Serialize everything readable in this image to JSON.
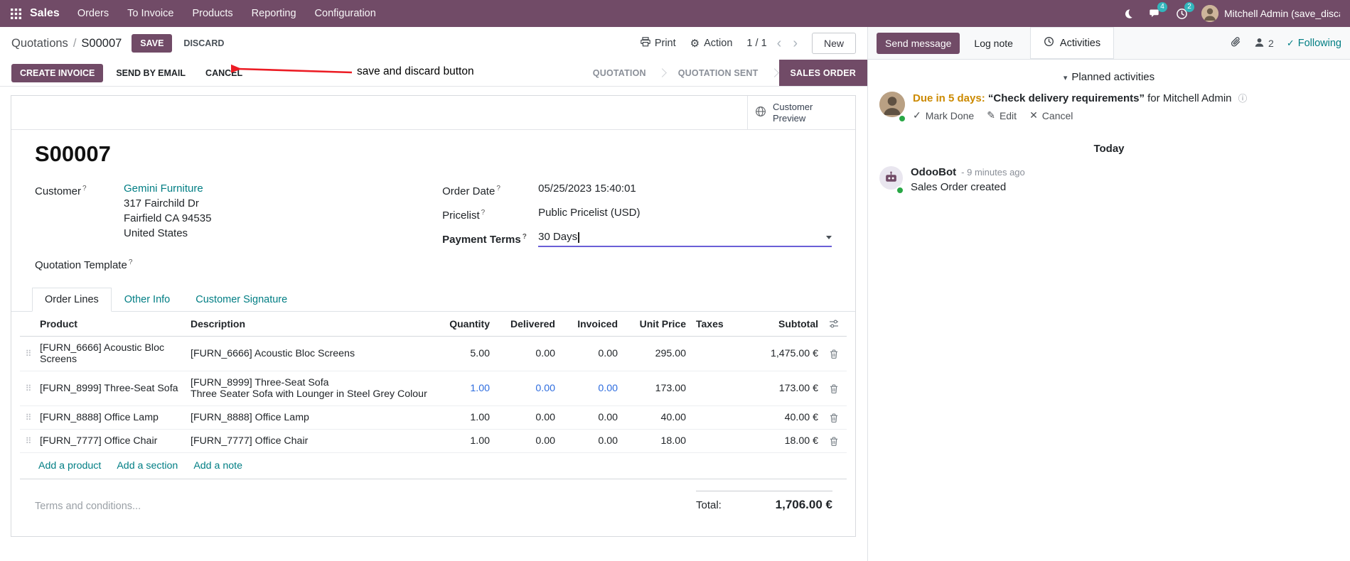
{
  "colors": {
    "primary": "#714B67",
    "link": "#017e84",
    "edited_blue": "#2d6cdf",
    "annotation_red": "#ec1c24",
    "due_orange": "#cc8a00",
    "success_green": "#28a745"
  },
  "nav": {
    "app": "Sales",
    "menus": [
      "Orders",
      "To Invoice",
      "Products",
      "Reporting",
      "Configuration"
    ],
    "badges": {
      "messages": "4",
      "activities": "2"
    },
    "user": "Mitchell Admin (save_discar"
  },
  "cp": {
    "breadcrumb_parent": "Quotations",
    "sep": "/",
    "breadcrumb_current": "S00007",
    "save": "SAVE",
    "discard": "DISCARD",
    "annotation": "save and discard button",
    "print": "Print",
    "action": "Action",
    "pager": "1 / 1",
    "prev": "‹",
    "next": "›",
    "new": "New"
  },
  "sb": {
    "create_invoice": "CREATE INVOICE",
    "send_by_email": "SEND BY EMAIL",
    "cancel": "CANCEL",
    "states": [
      "QUOTATION",
      "QUOTATION SENT",
      "SALES ORDER"
    ],
    "active_state": "SALES ORDER"
  },
  "form": {
    "customer_preview": "Customer Preview",
    "title": "S00007",
    "help": "?",
    "customer": {
      "label": "Customer",
      "name": "Gemini Furniture",
      "addr1": "317 Fairchild Dr",
      "addr2": "Fairfield CA 94535",
      "addr3": "United States"
    },
    "quotation_template": {
      "label": "Quotation Template"
    },
    "order_date": {
      "label": "Order Date",
      "value": "05/25/2023 15:40:01"
    },
    "pricelist": {
      "label": "Pricelist",
      "value": "Public Pricelist (USD)"
    },
    "payment_terms": {
      "label": "Payment Terms",
      "value": "30 Days"
    },
    "tabs": [
      "Order Lines",
      "Other Info",
      "Customer Signature"
    ],
    "table": {
      "headers": [
        "Product",
        "Description",
        "Quantity",
        "Delivered",
        "Invoiced",
        "Unit Price",
        "Taxes",
        "Subtotal"
      ],
      "rows": [
        {
          "product": "[FURN_6666] Acoustic Bloc Screens",
          "desc": "[FURN_6666] Acoustic Bloc Screens",
          "desc2": "",
          "qty": "5.00",
          "delivered": "0.00",
          "invoiced": "0.00",
          "price": "295.00",
          "taxes": "",
          "subtotal": "1,475.00 €"
        },
        {
          "product": "[FURN_8999] Three-Seat Sofa",
          "desc": "[FURN_8999] Three-Seat Sofa",
          "desc2": "Three Seater Sofa with Lounger in Steel Grey Colour",
          "qty": "1.00",
          "delivered": "0.00",
          "invoiced": "0.00",
          "price": "173.00",
          "taxes": "",
          "subtotal": "173.00 €"
        },
        {
          "product": "[FURN_8888] Office Lamp",
          "desc": "[FURN_8888] Office Lamp",
          "desc2": "",
          "qty": "1.00",
          "delivered": "0.00",
          "invoiced": "0.00",
          "price": "40.00",
          "taxes": "",
          "subtotal": "40.00 €"
        },
        {
          "product": "[FURN_7777] Office Chair",
          "desc": "[FURN_7777] Office Chair",
          "desc2": "",
          "qty": "1.00",
          "delivered": "0.00",
          "invoiced": "0.00",
          "price": "18.00",
          "taxes": "",
          "subtotal": "18.00 €"
        }
      ]
    },
    "links": [
      "Add a product",
      "Add a section",
      "Add a note"
    ],
    "terms_placeholder": "Terms and conditions...",
    "total_label": "Total:",
    "total_value": "1,706.00 €"
  },
  "chat": {
    "send_message": "Send message",
    "log_note": "Log note",
    "activities": "Activities",
    "followers": "2",
    "following": "Following",
    "planned_header": "Planned activities",
    "activity": {
      "due": "Due in 5 days:",
      "summary": "“Check delivery requirements”",
      "for_user": "for Mitchell Admin",
      "mark_done": "Mark Done",
      "edit": "Edit",
      "cancel": "Cancel"
    },
    "today": "Today",
    "msg": {
      "author": "OdooBot",
      "time": "- 9 minutes ago",
      "body": "Sales Order created"
    }
  }
}
